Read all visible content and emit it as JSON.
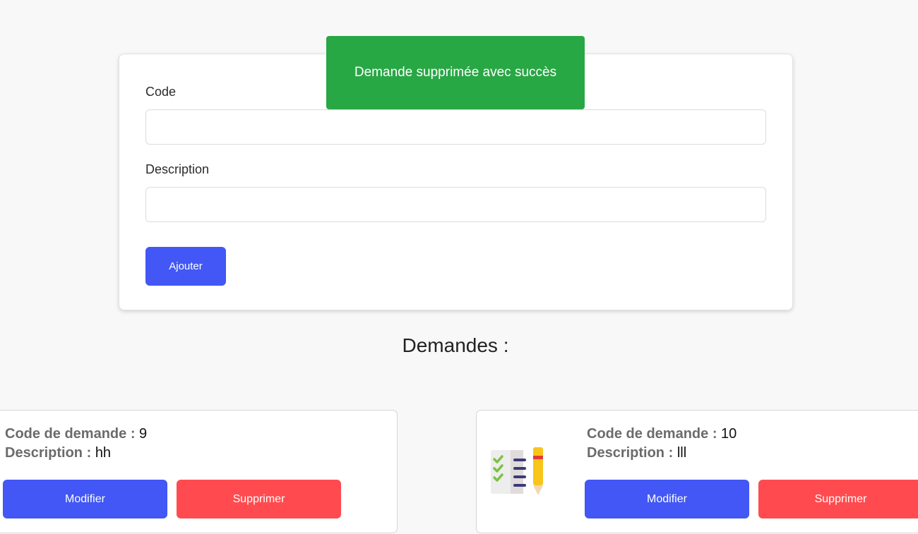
{
  "form": {
    "code_label": "Code",
    "code_value": "",
    "description_label": "Description",
    "description_value": "",
    "submit_label": "Ajouter"
  },
  "toast": {
    "message": "Demande supprimée avec succès",
    "color": "#28a745"
  },
  "list": {
    "title": "Demandes :",
    "code_prefix": "Code de demande :",
    "description_prefix": "Description :",
    "edit_label": "Modifier",
    "delete_label": "Supprimer",
    "items": [
      {
        "code": "9",
        "description": "hh",
        "icon": ""
      },
      {
        "code": "10",
        "description": "lll",
        "icon": "checklist-document-icon"
      }
    ]
  },
  "colors": {
    "primary": "#4257f5",
    "danger": "#ff4b4f",
    "background": "#f8f8f8"
  }
}
